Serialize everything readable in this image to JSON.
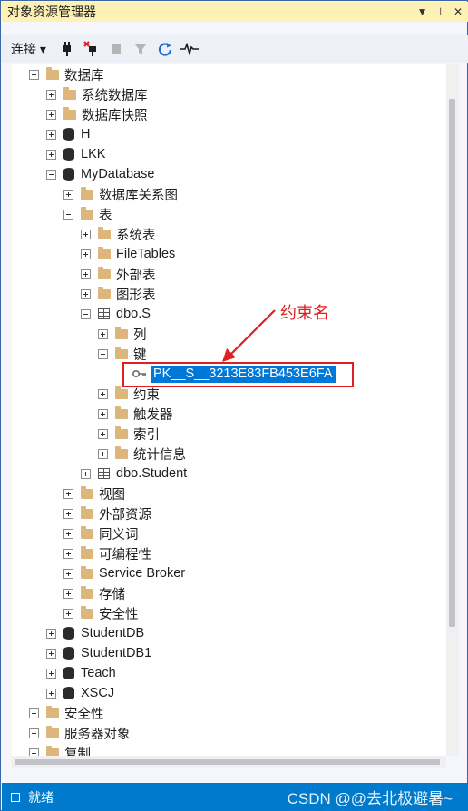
{
  "title": "对象资源管理器",
  "title_buttons": {
    "dropdown": "▼",
    "pin": "⊥",
    "close": "✕"
  },
  "toolbar": {
    "connect_label": "连接 ▾"
  },
  "annotation": "约束名",
  "tree": [
    {
      "label": "数据库",
      "icon": "folder",
      "expander": "minus"
    },
    {
      "label": "系统数据库",
      "icon": "folder",
      "expander": "plus"
    },
    {
      "label": "数据库快照",
      "icon": "folder",
      "expander": "plus"
    },
    {
      "label": "H",
      "icon": "database",
      "expander": "plus"
    },
    {
      "label": "LKK",
      "icon": "database",
      "expander": "plus"
    },
    {
      "label": "MyDatabase",
      "icon": "database",
      "expander": "minus"
    },
    {
      "label": "数据库关系图",
      "icon": "folder",
      "expander": "plus"
    },
    {
      "label": "表",
      "icon": "folder",
      "expander": "minus"
    },
    {
      "label": "系统表",
      "icon": "folder",
      "expander": "plus"
    },
    {
      "label": "FileTables",
      "icon": "folder",
      "expander": "plus"
    },
    {
      "label": "外部表",
      "icon": "folder",
      "expander": "plus"
    },
    {
      "label": "图形表",
      "icon": "folder",
      "expander": "plus"
    },
    {
      "label": "dbo.S",
      "icon": "table",
      "expander": "minus"
    },
    {
      "label": "列",
      "icon": "folder",
      "expander": "plus"
    },
    {
      "label": "键",
      "icon": "folder",
      "expander": "minus"
    },
    {
      "label": "PK__S__3213E83FB453E6FA",
      "icon": "key",
      "expander": "none",
      "selected": true
    },
    {
      "label": "约束",
      "icon": "folder",
      "expander": "plus"
    },
    {
      "label": "触发器",
      "icon": "folder",
      "expander": "plus"
    },
    {
      "label": "索引",
      "icon": "folder",
      "expander": "plus"
    },
    {
      "label": "统计信息",
      "icon": "folder",
      "expander": "plus"
    },
    {
      "label": "dbo.Student",
      "icon": "table",
      "expander": "plus"
    },
    {
      "label": "视图",
      "icon": "folder",
      "expander": "plus"
    },
    {
      "label": "外部资源",
      "icon": "folder",
      "expander": "plus"
    },
    {
      "label": "同义词",
      "icon": "folder",
      "expander": "plus"
    },
    {
      "label": "可编程性",
      "icon": "folder",
      "expander": "plus"
    },
    {
      "label": "Service Broker",
      "icon": "folder",
      "expander": "plus"
    },
    {
      "label": "存储",
      "icon": "folder",
      "expander": "plus"
    },
    {
      "label": "安全性",
      "icon": "folder",
      "expander": "plus"
    },
    {
      "label": "StudentDB",
      "icon": "database",
      "expander": "plus"
    },
    {
      "label": "StudentDB1",
      "icon": "database",
      "expander": "plus"
    },
    {
      "label": "Teach",
      "icon": "database",
      "expander": "plus"
    },
    {
      "label": "XSCJ",
      "icon": "database",
      "expander": "plus"
    },
    {
      "label": "安全性",
      "icon": "folder",
      "expander": "plus"
    },
    {
      "label": "服务器对象",
      "icon": "folder",
      "expander": "plus"
    },
    {
      "label": "复制",
      "icon": "folder",
      "expander": "plus"
    }
  ],
  "status": {
    "text": "就绪",
    "watermark": "CSDN @@去北极避暑~"
  },
  "colors": {
    "accent": "#007acc",
    "selection": "#0078d7",
    "annotation": "#e02020",
    "title_bg": "#fef1b6"
  }
}
